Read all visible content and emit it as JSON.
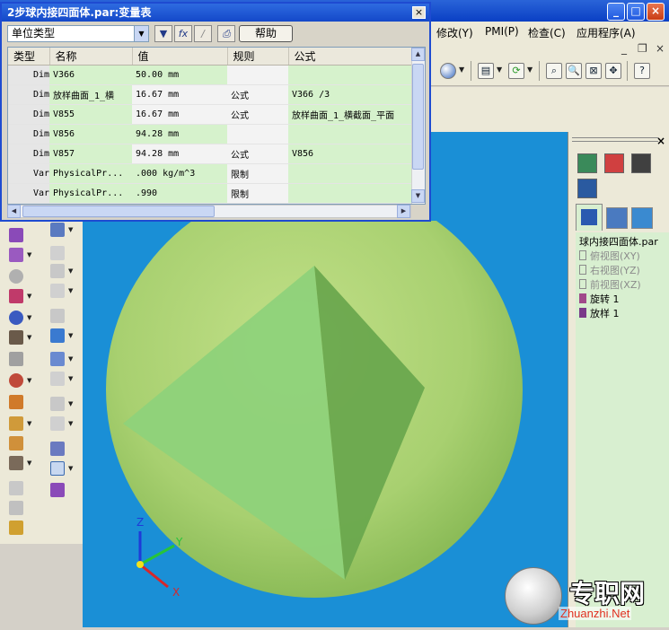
{
  "dialog": {
    "title": "2步球内接四面体.par:变量表",
    "close_glyph": "×",
    "filter_value": "单位类型",
    "help_label": "帮助",
    "columns": [
      "类型",
      "名称",
      "值",
      "规则",
      "公式"
    ],
    "rows": [
      {
        "type": "Dim",
        "name": "V366",
        "value": "50.00 mm",
        "rule": "",
        "formula": ""
      },
      {
        "type": "Dim",
        "name": "放样曲面_1_横",
        "value": "16.67 mm",
        "rule": "公式",
        "formula": "V366 /3"
      },
      {
        "type": "Dim",
        "name": "V855",
        "value": "16.67 mm",
        "rule": "公式",
        "formula": "放样曲面_1_横截面_平面"
      },
      {
        "type": "Dim",
        "name": "V856",
        "value": "94.28 mm",
        "rule": "",
        "formula": ""
      },
      {
        "type": "Dim",
        "name": "V857",
        "value": "94.28 mm",
        "rule": "公式",
        "formula": "V856"
      },
      {
        "type": "Var",
        "name": "PhysicalPr...",
        "value": ".000 kg/m^3",
        "rule": "限制",
        "formula": ""
      },
      {
        "type": "Var",
        "name": "PhysicalPr...",
        "value": ".990",
        "rule": "限制",
        "formula": ""
      }
    ]
  },
  "menu": {
    "items": [
      "修改(Y)",
      "PMI(P)",
      "检查(C)",
      "应用程序(A)"
    ],
    "mdi_min": "_",
    "mdi_restore": "❐",
    "mdi_close": "×"
  },
  "window_buttons": {
    "minimize": "_",
    "maximize": "□",
    "close": "×"
  },
  "pathfinder": {
    "close_glyph": "×",
    "root": "球内接四面体.par",
    "items": [
      {
        "label": "俯视图(XY)",
        "state": "hidden"
      },
      {
        "label": "右视图(YZ)",
        "state": "hidden"
      },
      {
        "label": "前视图(XZ)",
        "state": "hidden"
      },
      {
        "label": "旋转 1",
        "state": "active"
      },
      {
        "label": "放样 1",
        "state": "active"
      }
    ]
  },
  "triad": {
    "x": "X",
    "y": "Y",
    "z": "Z"
  },
  "watermark": {
    "text": "专职网",
    "url": "Zhuanzhi.Net"
  },
  "colors": {
    "viewport_bg": "#1a8fd6",
    "sphere": "#a8d070",
    "tetra_face_light": "#8ed27a",
    "tetra_face_dark": "#6aa84e",
    "grid_highlight": "#d6f2cc",
    "title_bar": "#1448c9"
  }
}
